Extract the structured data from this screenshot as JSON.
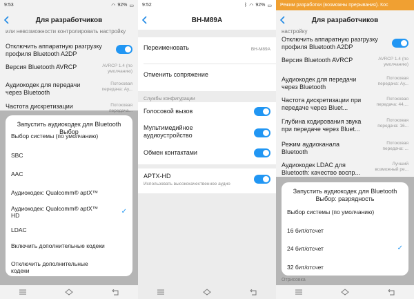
{
  "left": {
    "status": {
      "time": "9:53",
      "battery": "92%"
    },
    "title": "Для разработчиков",
    "rows": [
      {
        "label": "или невозможности контролировать настройку"
      },
      {
        "label": "Отключить аппаратную разгрузку профиля Bluetooth A2DP"
      },
      {
        "label": "Версия Bluetooth AVRCP",
        "value": "AVRCP 1.4 (по умолчанию)"
      },
      {
        "label": "Аудиокодек для передачи через Bluetooth",
        "value": "Потоковая передача: Ау..."
      },
      {
        "label": "Частота дискретизации",
        "value": "Потоковая передача..."
      }
    ],
    "dialog": {
      "title": "Запустить аудиокодек для Bluetooth Выбор",
      "options": [
        "Выбор системы (по умолчанию)",
        "SBC",
        "AAC",
        "Аудиокодек: Qualcomm® aptX™",
        "Аудиокодек: Qualcomm® aptX™ HD",
        "LDAC",
        "Включить дополнительные кодеки",
        "Отключить дополнительные кодеки"
      ],
      "selected_index": 4
    }
  },
  "middle": {
    "status": {
      "time": "9:52",
      "battery": "92%"
    },
    "title": "BH-M89A",
    "rename": {
      "label": "Переименовать",
      "value": "BH-M89A"
    },
    "unpair": "Отменить сопряжение",
    "section": "Службы конфигурации",
    "services": [
      "Голосовой вызов",
      "Мультимедийное аудиоустройство",
      "Обмен контактами"
    ],
    "aptx": {
      "label": "APTX-HD",
      "sub": "Использовать высококачественное аудио"
    }
  },
  "right": {
    "banner": "Режим разработки (возможны прерывания). Кос",
    "title": "Для разработчиков",
    "rows": [
      {
        "label": "настройку"
      },
      {
        "label": "Отключить аппаратную разгрузку профиля Bluetooth A2DP"
      },
      {
        "label": "Версия Bluetooth AVRCP",
        "value": "AVRCP 1.4 (по умолчанию)"
      },
      {
        "label": "Аудиокодек для передачи через Bluetooth",
        "value": "Потоковая передача: Ау..."
      },
      {
        "label": "Частота дискретизации при передаче через Bluet...",
        "value": "Потоковая передача: 44,..."
      },
      {
        "label": "Глубина кодирования звука при передаче через Bluet...",
        "value": "Потоковая передача: 16..."
      },
      {
        "label": "Режим аудиоканала Bluetooth",
        "value": "Потоковая передача: ..."
      },
      {
        "label": "Аудиокодек LDAC для Bluetooth: качество воспр...",
        "value": "Лучший возможный ре..."
      }
    ],
    "dialog": {
      "title": "Запустить аудиокодек для Bluetooth Выбор: разрядность",
      "options": [
        "Выбор системы (по умолчанию)",
        "16 бит/отсчет",
        "24 бит/отсчет",
        "32 бит/отсчет"
      ],
      "selected_index": 2
    },
    "footer": "Отрисовка"
  },
  "colors": {
    "accent": "#2196f3",
    "banner": "#f0a032"
  }
}
